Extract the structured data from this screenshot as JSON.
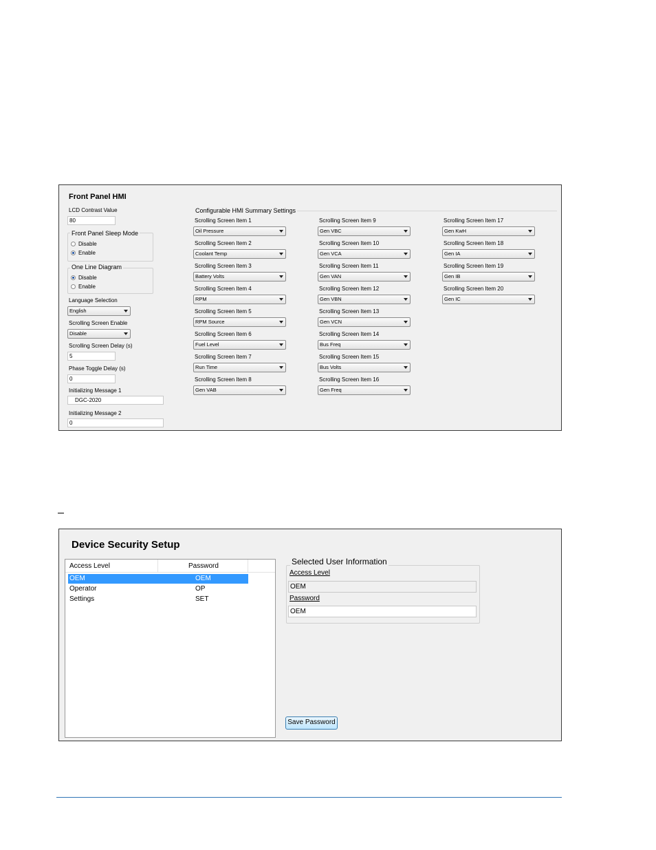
{
  "hmi": {
    "title": "Front Panel HMI",
    "lcd_contrast_label": "LCD Contrast Value",
    "lcd_contrast_value": "80",
    "sleep_group_title": "Front Panel Sleep Mode",
    "sleep_options": [
      {
        "label": "Disable",
        "selected": false
      },
      {
        "label": "Enable",
        "selected": true
      }
    ],
    "oneline_group_title": "One Line Diagram",
    "oneline_options": [
      {
        "label": "Disable",
        "selected": true
      },
      {
        "label": "Enable",
        "selected": false
      }
    ],
    "language_label": "Language Selection",
    "language_value": "English",
    "scroll_enable_label": "Scrolling Screen Enable",
    "scroll_enable_value": "Disable",
    "scroll_delay_label": "Scrolling Screen Delay (s)",
    "scroll_delay_value": "5",
    "phase_toggle_label": "Phase Toggle Delay (s)",
    "phase_toggle_value": "0",
    "init_msg1_label": "Initializing Message 1",
    "init_msg1_value": "DGC-2020",
    "init_msg2_label": "Initializing Message 2",
    "init_msg2_value": "0",
    "summary_title": "Configurable HMI Summary Settings",
    "items": [
      {
        "label": "Scrolling Screen Item 1",
        "value": "Oil Pressure"
      },
      {
        "label": "Scrolling Screen Item 2",
        "value": "Coolant Temp"
      },
      {
        "label": "Scrolling Screen Item 3",
        "value": "Battery Volts"
      },
      {
        "label": "Scrolling Screen Item 4",
        "value": "RPM"
      },
      {
        "label": "Scrolling Screen Item 5",
        "value": "RPM Source"
      },
      {
        "label": "Scrolling Screen Item 6",
        "value": "Fuel Level"
      },
      {
        "label": "Scrolling Screen Item 7",
        "value": "Run Time"
      },
      {
        "label": "Scrolling Screen Item 8",
        "value": "Gen VAB"
      },
      {
        "label": "Scrolling Screen Item 9",
        "value": "Gen VBC"
      },
      {
        "label": "Scrolling Screen Item 10",
        "value": "Gen VCA"
      },
      {
        "label": "Scrolling Screen Item 11",
        "value": "Gen VAN"
      },
      {
        "label": "Scrolling Screen Item 12",
        "value": "Gen VBN"
      },
      {
        "label": "Scrolling Screen Item 13",
        "value": "Gen VCN"
      },
      {
        "label": "Scrolling Screen Item 14",
        "value": "Bus Freq"
      },
      {
        "label": "Scrolling Screen Item 15",
        "value": "Bus Volts"
      },
      {
        "label": "Scrolling Screen Item 16",
        "value": "Gen Freq"
      },
      {
        "label": "Scrolling Screen Item 17",
        "value": "Gen KwH"
      },
      {
        "label": "Scrolling Screen Item 18",
        "value": "Gen IA"
      },
      {
        "label": "Scrolling Screen Item 19",
        "value": "Gen IB"
      },
      {
        "label": "Scrolling Screen Item 20",
        "value": "Gen IC"
      }
    ]
  },
  "security": {
    "title": "Device Security Setup",
    "col_access": "Access Level",
    "col_password": "Password",
    "rows": [
      {
        "access": "OEM",
        "password": "OEM",
        "selected": true
      },
      {
        "access": "Operator",
        "password": "OP",
        "selected": false
      },
      {
        "access": "Settings",
        "password": "SET",
        "selected": false
      }
    ],
    "info_title": "Selected User Information",
    "access_label": "Access Level",
    "access_value": "OEM",
    "password_label": "Password",
    "password_value": "OEM",
    "save_button": "Save Password"
  }
}
